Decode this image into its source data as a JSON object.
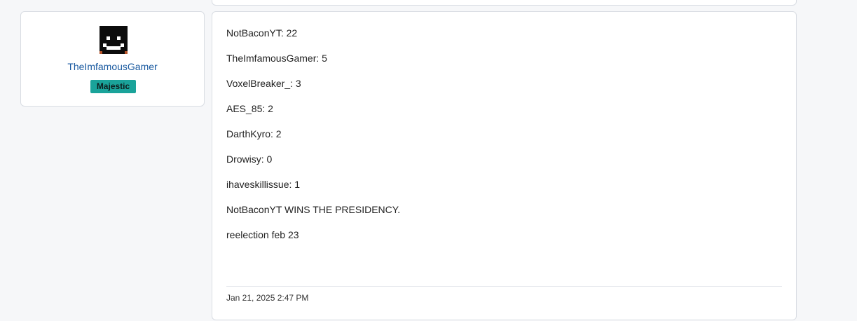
{
  "author": {
    "username": "TheImfamousGamer",
    "rank_badge": "Majestic",
    "badge_color": "#1aa39a",
    "avatar_icon": "blocky-face-avatar"
  },
  "post": {
    "lines": [
      "NotBaconYT: 22",
      "TheImfamousGamer: 5",
      "VoxelBreaker_: 3",
      "AES_85: 2",
      "DarthKyro: 2",
      "Drowisy: 0",
      "ihaveskillissue: 1",
      "NotBaconYT WINS THE PRESIDENCY.",
      "reelection feb 23"
    ],
    "date": "Jan 21, 2025 2:47 PM"
  }
}
